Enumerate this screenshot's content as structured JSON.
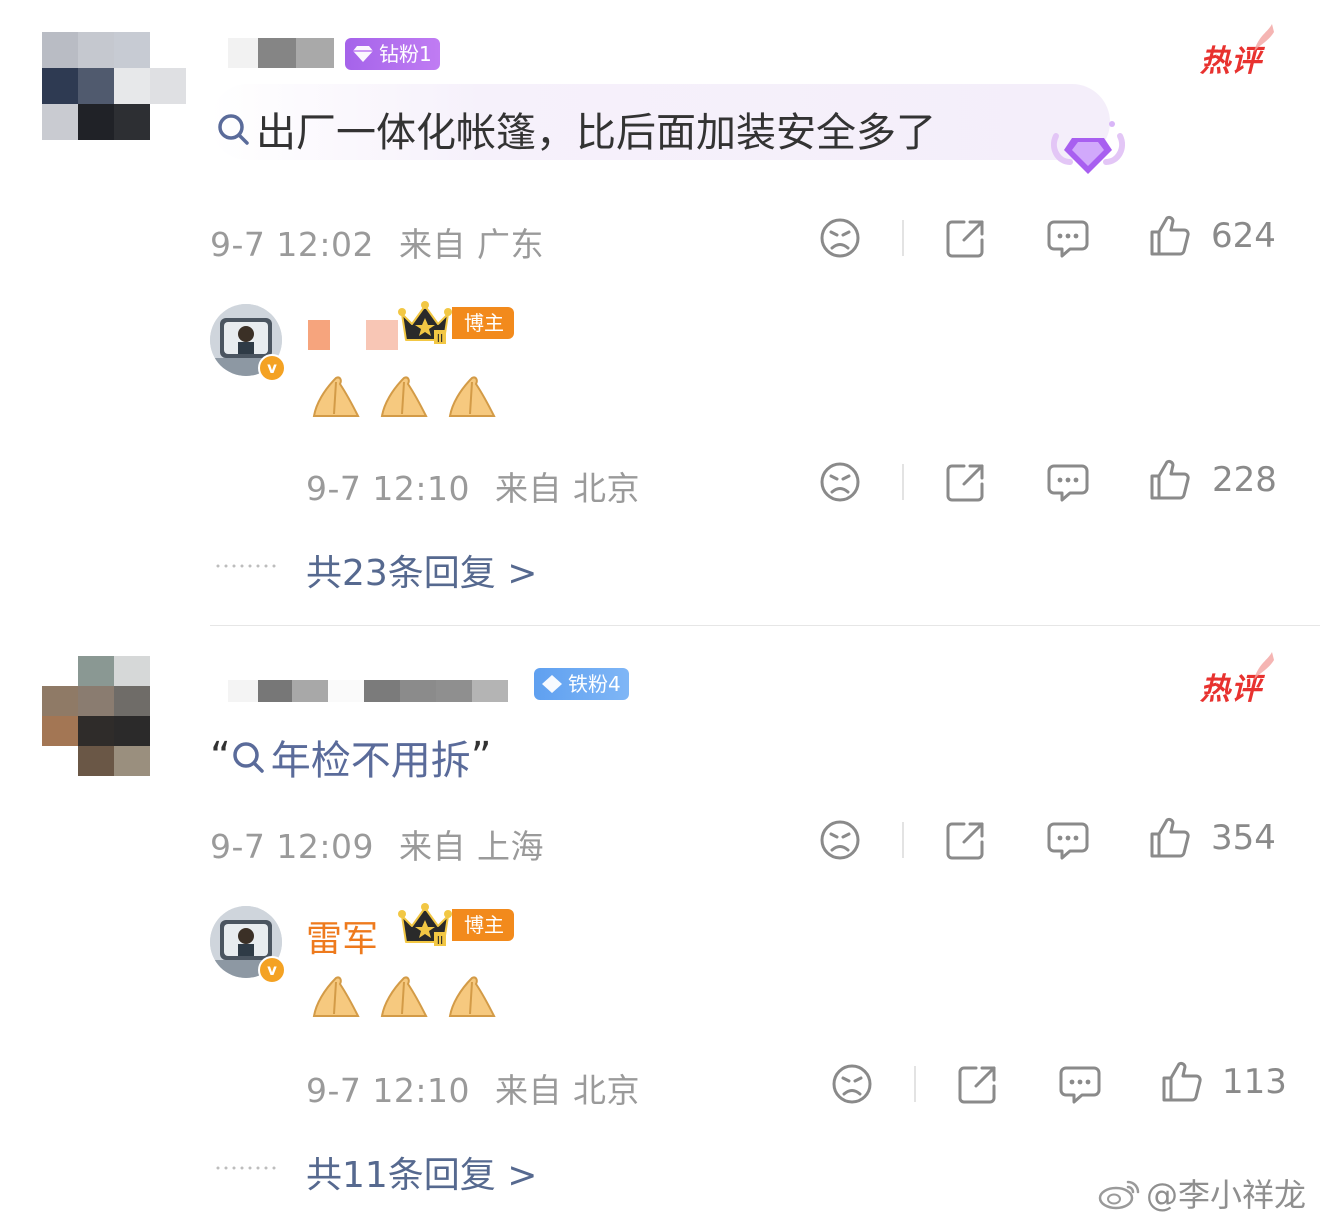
{
  "comments": [
    {
      "fan_badge": "钻粉1",
      "hot_label": "热评",
      "text": "出厂一体化帐篷，比后面加装安全多了",
      "timestamp": "9-7 12:02",
      "location": "来自 广东",
      "likes": "624",
      "reply": {
        "name": "",
        "badge": "博主",
        "timestamp": "9-7 12:10",
        "location": "来自 北京",
        "likes": "228"
      },
      "more_replies": "共23条回复 >"
    },
    {
      "fan_badge": "铁粉4",
      "hot_label": "热评",
      "text_open_quote": "“",
      "text": "年检不用拆",
      "text_close_quote": "”",
      "timestamp": "9-7 12:09",
      "location": "来自 上海",
      "likes": "354",
      "reply": {
        "name": "雷军",
        "badge": "博主",
        "timestamp": "9-7 12:10",
        "location": "来自 北京",
        "likes": "113"
      },
      "more_replies": "共11条回复 >"
    }
  ],
  "watermark": "@李小祥龙",
  "icons": [
    "search-icon",
    "dislike-icon",
    "share-icon",
    "comment-icon",
    "like-icon",
    "diamond-icon",
    "crown-icon",
    "verified-icon",
    "clap-emoji",
    "weibo-logo-icon"
  ],
  "colors": {
    "hot": "#e8322f",
    "link": "#5a6b9a",
    "blogger": "#f28a1c",
    "diamond_fan": "#b069e8",
    "iron_fan": "#6aa6f2"
  }
}
